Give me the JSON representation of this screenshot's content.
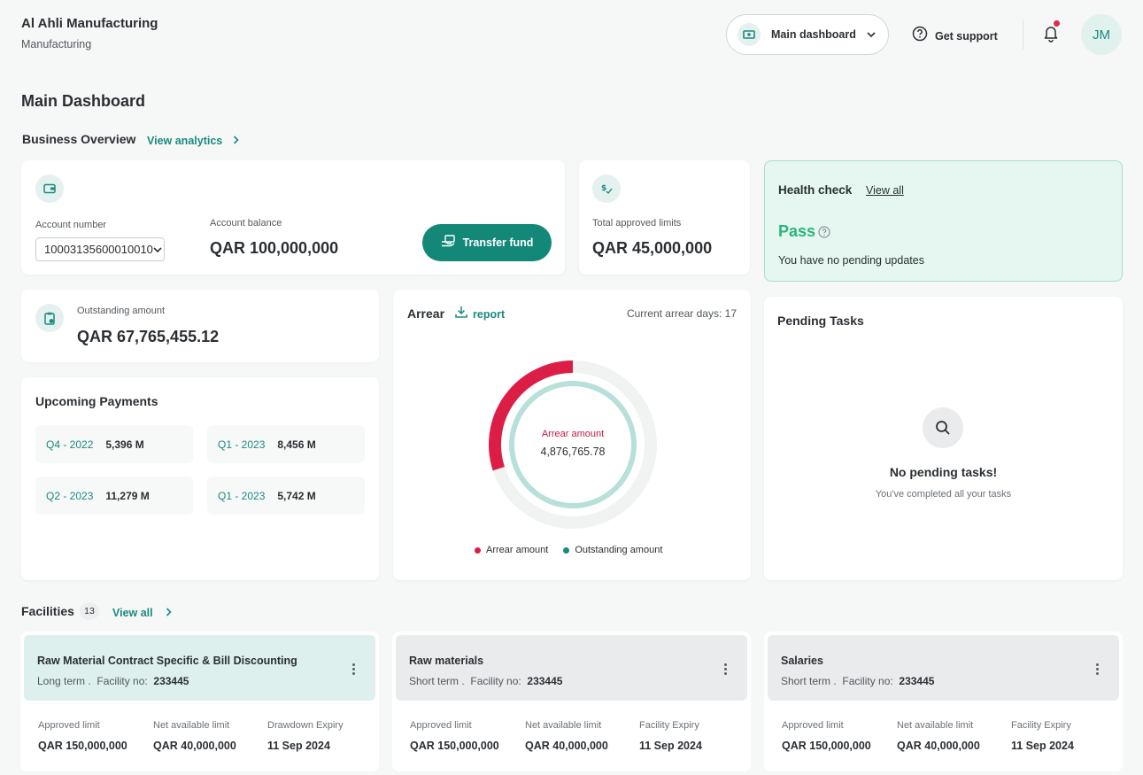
{
  "company": {
    "name": "Al Ahli Manufacturing",
    "sector": "Manufacturing"
  },
  "header": {
    "dashboard_select": "Main dashboard",
    "support": "Get support",
    "avatar": "JM",
    "notification_dot_color": "#e0294a"
  },
  "page_title": "Main Dashboard",
  "overview": {
    "title": "Business Overview",
    "view_analytics": "View analytics"
  },
  "account": {
    "number_label": "Account number",
    "number": "10003135600010010",
    "balance_label": "Account balance",
    "balance": "QAR 100,000,000",
    "transfer_button": "Transfer fund"
  },
  "approved": {
    "label": "Total approved limits",
    "value": "QAR 45,000,000"
  },
  "health": {
    "title": "Health check",
    "view_all": "View all",
    "status": "Pass",
    "message": "You have no pending updates"
  },
  "outstanding": {
    "label": "Outstanding amount",
    "value": "QAR 67,765,455.12"
  },
  "payments": {
    "title": "Upcoming Payments",
    "items": [
      {
        "quarter": "Q4 - 2022",
        "amount": "5,396 M"
      },
      {
        "quarter": "Q1 - 2023",
        "amount": "8,456 M"
      },
      {
        "quarter": "Q2 - 2023",
        "amount": "11,279 M"
      },
      {
        "quarter": "Q1 - 2023",
        "amount": "5,742 M"
      }
    ]
  },
  "arrear": {
    "title": "Arrear",
    "report": "report",
    "days": "Current arrear days: 17",
    "center_label": "Arrear amount",
    "center_value": "4,876,765.78",
    "legend": [
      "Arrear amount",
      "Outstanding amount"
    ],
    "arrear_fraction": 0.3,
    "colors": {
      "arrear": "#dc1e47",
      "outstanding": "#b6e0d9"
    }
  },
  "pending": {
    "title": "Pending Tasks",
    "empty_title": "No pending tasks!",
    "empty_sub": "You've completed all your tasks"
  },
  "facilities": {
    "title": "Facilities",
    "count": "13",
    "view_all": "View all",
    "items": [
      {
        "title": "Raw Material Contract Specific & Bill Discounting",
        "term": "Long term",
        "facility_label": "Facility no:",
        "facility_no": "233445",
        "c1_label": "Approved limit",
        "c1": "QAR 150,000,000",
        "c2_label": "Net available limit",
        "c2": "QAR 40,000,000",
        "c3_label": "Drawdown Expiry",
        "c3": "11 Sep 2024"
      },
      {
        "title": "Raw materials",
        "term": "Short term",
        "facility_label": "Facility no:",
        "facility_no": "233445",
        "c1_label": "Approved limit",
        "c1": "QAR 150,000,000",
        "c2_label": "Net available limit",
        "c2": "QAR 40,000,000",
        "c3_label": "Facility Expiry",
        "c3": "11 Sep 2024"
      },
      {
        "title": "Salaries",
        "term": "Short term",
        "facility_label": "Facility no:",
        "facility_no": "233445",
        "c1_label": "Approved limit",
        "c1": "QAR 150,000,000",
        "c2_label": "Net available limit",
        "c2": "QAR 40,000,000",
        "c3_label": "Facility Expiry",
        "c3": "11 Sep 2024"
      }
    ]
  }
}
